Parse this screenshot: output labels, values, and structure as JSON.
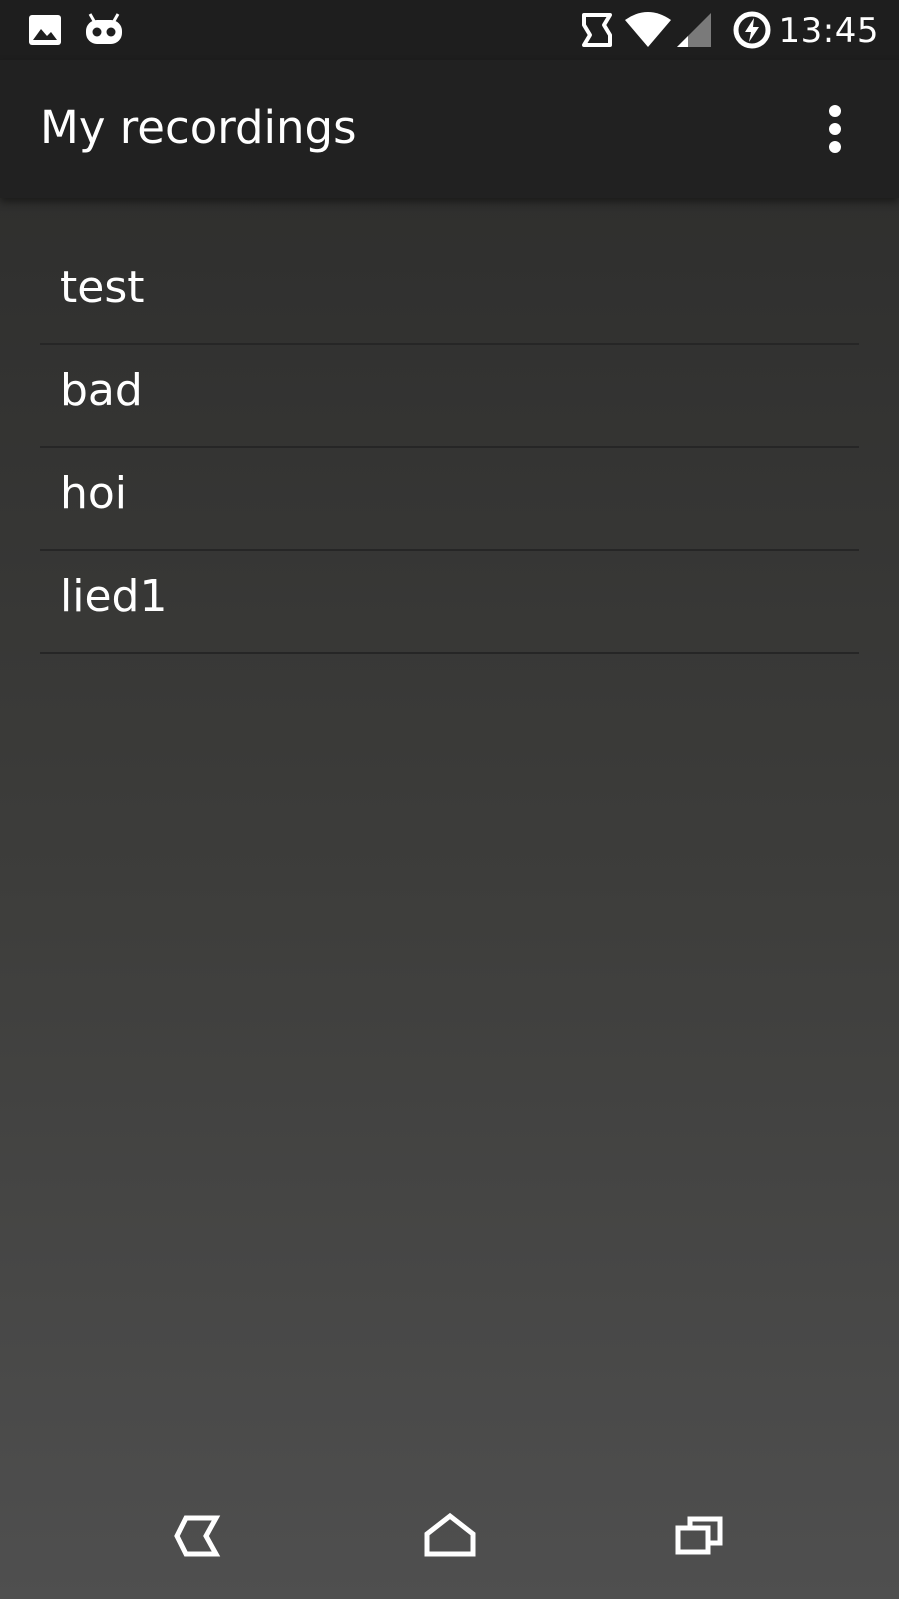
{
  "status_bar": {
    "time": "13:45",
    "left_icons": [
      "image-icon",
      "android-icon"
    ],
    "right_icons": [
      "sync-icon",
      "wifi-icon",
      "signal-icon",
      "battery-charging-icon"
    ]
  },
  "app_bar": {
    "title": "My recordings",
    "menu_icon": "more-vert-icon"
  },
  "recordings": [
    {
      "name": "test"
    },
    {
      "name": "bad"
    },
    {
      "name": "hoi"
    },
    {
      "name": "lied1"
    }
  ],
  "nav_bar": {
    "icons": [
      "back-icon",
      "home-icon",
      "recents-icon"
    ]
  },
  "colors": {
    "status_bar_bg": "#1e1e1e",
    "app_bar_bg": "#212121",
    "list_bg_top": "#2b2b2a",
    "list_bg_bottom": "#4f4f4f",
    "divider": "#262626",
    "text": "#ffffff"
  }
}
